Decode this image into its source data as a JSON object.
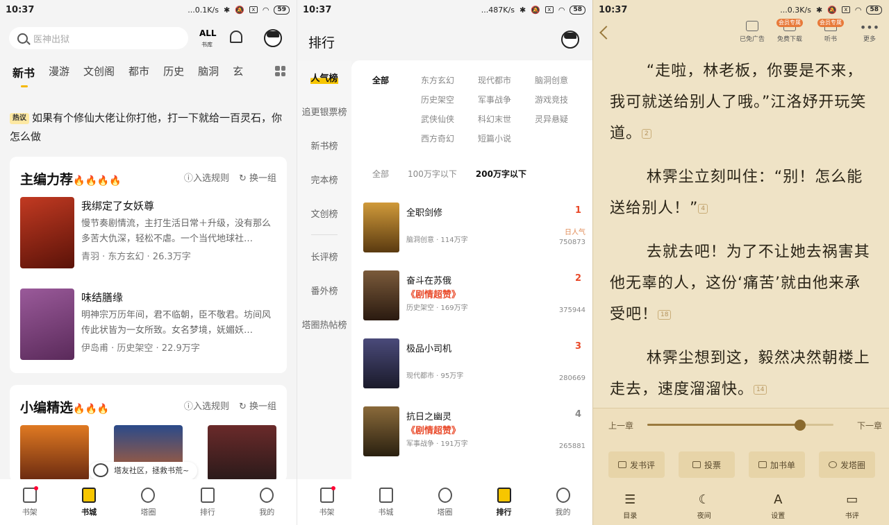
{
  "panel1": {
    "status": {
      "time": "10:37",
      "speed": "...0.1K/s",
      "battery": "59"
    },
    "search_placeholder": "医神出狱",
    "all_label": "ALL",
    "all_sub": "书库",
    "categories": [
      "新书",
      "漫游",
      "文创阁",
      "都市",
      "历史",
      "脑洞",
      "玄"
    ],
    "hot_tag": "热议",
    "hot_text": "如果有个修仙大佬让你打他，打一下就给一百灵石，你怎么做",
    "editor": {
      "title": "主编力荐",
      "fires": "🔥🔥🔥🔥",
      "rule": "入选规则",
      "swap": "换一组",
      "books": [
        {
          "title": "我绑定了女妖尊",
          "desc": "慢节奏剧情流，主打生活日常＋升级，没有那么多苦大仇深，轻松不虐。一个当代地球社…",
          "meta": "青羽 · 东方玄幻 · 26.3万字",
          "cover_color": "#8a2a1a"
        },
        {
          "title": "味结膳缘",
          "desc": "明神宗万历年间，君不临朝，臣不敬君。坊间风传此状皆为一女所致。女名梦境，妩媚妖…",
          "meta": "伊岛甫 · 历史架空 · 22.9万字",
          "cover_color": "#7a4a7a"
        }
      ]
    },
    "picks": {
      "title": "小编精选",
      "fires": "🔥🔥🔥",
      "rule": "入选规则",
      "swap": "换一组"
    },
    "bubble": "塔友社区，拯救书荒~",
    "tabs": [
      "书架",
      "书城",
      "塔圈",
      "排行",
      "我的"
    ]
  },
  "panel2": {
    "status": {
      "time": "10:37",
      "speed": "...487K/s",
      "battery": "58"
    },
    "title": "排行",
    "side": [
      "人气榜",
      "追更银票榜",
      "新书榜",
      "完本榜",
      "文创榜",
      "长评榜",
      "番外榜",
      "塔圈热帖榜"
    ],
    "filters": [
      "全部",
      "东方玄幻",
      "现代都市",
      "脑洞创意",
      "",
      "历史架空",
      "军事战争",
      "游戏竞技",
      "",
      "武侠仙侠",
      "科幻末世",
      "灵异悬疑",
      "",
      "西方奇幻",
      "短篇小说",
      ""
    ],
    "lengths": [
      "全部",
      "100万字以下",
      "200万字以下"
    ],
    "ranks": [
      {
        "name": "全职剑修",
        "badge": "",
        "meta": "脑洞创意 · 114万字",
        "no": "1",
        "label": "日人气",
        "value": "750873",
        "cover": "#b07a2a"
      },
      {
        "name": "奋斗在苏俄",
        "badge": "《剧情超赞》",
        "meta": "历史架空 · 169万字",
        "no": "2",
        "label": "",
        "value": "375944",
        "cover": "#5a3a22"
      },
      {
        "name": "极品小司机",
        "badge": "",
        "meta": "现代都市 · 95万字",
        "no": "3",
        "label": "",
        "value": "280669",
        "cover": "#3a3a5a"
      },
      {
        "name": "抗日之幽灵",
        "badge": "《剧情超赞》",
        "meta": "军事战争 · 191万字",
        "no": "4",
        "label": "",
        "value": "265881",
        "cover": "#5a4a30"
      }
    ],
    "tabs": [
      "书架",
      "书城",
      "塔圈",
      "排行",
      "我的"
    ]
  },
  "panel3": {
    "status": {
      "time": "10:37",
      "speed": "...0.3K/s",
      "battery": "58"
    },
    "toolbar": {
      "ad": "已免广告",
      "download": "免费下载",
      "listen": "听书",
      "more": "更多",
      "vip": "会员专属"
    },
    "paragraphs": [
      {
        "text": "“走啦，林老板，你要是不来，我可就送给别人了哦。”江洛妤开玩笑道。",
        "note": "2"
      },
      {
        "text": "林霁尘立刻叫住：“别！怎么能送给别人！”",
        "note": "4"
      },
      {
        "text": "去就去吧！为了不让她去祸害其他无辜的人，这份‘痛苦’就由他来承受吧！",
        "note": "18"
      },
      {
        "text": "林霁尘想到这，毅然决然朝楼上走去，速度溜溜快。",
        "note": "14"
      }
    ],
    "prev": "上一章",
    "next": "下一章",
    "progress": 0.82,
    "buttons": [
      "发书评",
      "投票",
      "加书单",
      "发塔圈"
    ],
    "bottom": [
      "目录",
      "夜间",
      "设置",
      "书评"
    ]
  }
}
